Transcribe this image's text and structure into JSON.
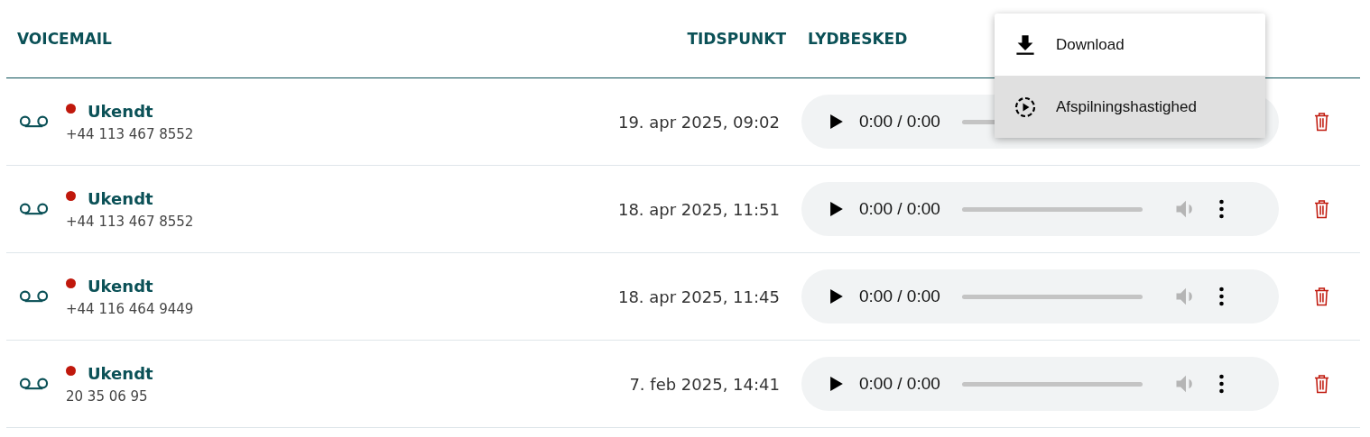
{
  "columns": [
    {
      "label": "VOICEMAIL"
    },
    {
      "label": "TIDSPUNKT"
    },
    {
      "label": "LYDBESKED"
    }
  ],
  "rows": [
    {
      "unread": true,
      "name": "Ukendt",
      "number": "+44 113 467 8552",
      "time": "19. apr 2025, 09:02",
      "player_time": "0:00 / 0:00",
      "menu_open": true
    },
    {
      "unread": true,
      "name": "Ukendt",
      "number": "+44 113 467 8552",
      "time": "18. apr 2025, 11:51",
      "player_time": "0:00 / 0:00",
      "menu_open": false
    },
    {
      "unread": true,
      "name": "Ukendt",
      "number": "+44 116 464 9449",
      "time": "18. apr 2025, 11:45",
      "player_time": "0:00 / 0:00",
      "menu_open": false
    },
    {
      "unread": true,
      "name": "Ukendt",
      "number": "20 35 06 95",
      "time": "7. feb 2025, 14:41",
      "player_time": "0:00 / 0:00",
      "menu_open": false
    }
  ],
  "menu": {
    "items": [
      {
        "kind": "download",
        "label": "Download",
        "selected": false
      },
      {
        "kind": "speed",
        "label": "Afspilningshastighed",
        "selected": true
      }
    ]
  }
}
